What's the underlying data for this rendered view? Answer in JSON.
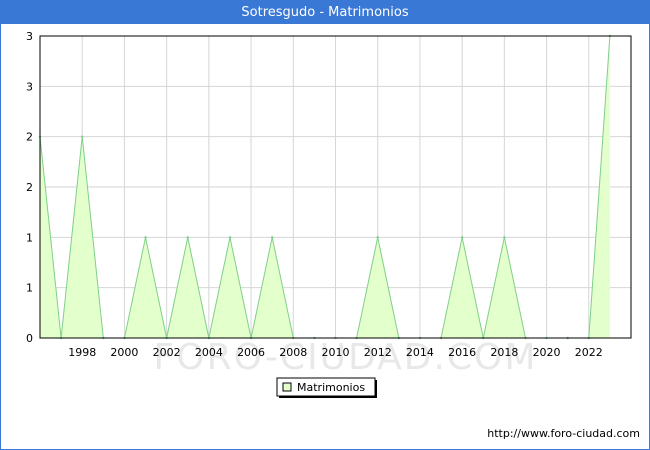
{
  "title": "Sotresgudo - Matrimonios",
  "footer_url": "http://www.foro-ciudad.com",
  "watermark": "FORO-CIUDAD.COM",
  "colors": {
    "title_bg": "#3a78d6",
    "fill": "#e3ffcc",
    "line": "#7fcf8a",
    "grid": "#d6d6d6"
  },
  "chart_data": {
    "type": "area",
    "title": "Sotresgudo - Matrimonios",
    "x": [
      1996,
      1997,
      1998,
      1999,
      2000,
      2001,
      2002,
      2003,
      2004,
      2005,
      2006,
      2007,
      2008,
      2009,
      2010,
      2011,
      2012,
      2013,
      2014,
      2015,
      2016,
      2017,
      2018,
      2019,
      2020,
      2021,
      2022,
      2023
    ],
    "series": [
      {
        "name": "Matrimonios",
        "values": [
          2,
          0,
          2,
          0,
          0,
          1,
          0,
          1,
          0,
          1,
          0,
          1,
          0,
          0,
          0,
          0,
          1,
          0,
          0,
          0,
          1,
          0,
          1,
          0,
          0,
          0,
          0,
          3
        ]
      }
    ],
    "x_ticks": [
      "1998",
      "2000",
      "2002",
      "2004",
      "2006",
      "2008",
      "2010",
      "2012",
      "2014",
      "2016",
      "2018",
      "2020",
      "2022"
    ],
    "y_ticks": [
      "0",
      "1",
      "1",
      "2",
      "2",
      "3",
      "3"
    ],
    "ylim": [
      0,
      3
    ],
    "xlim": [
      1996,
      2024
    ],
    "grid": true,
    "legend_position": "bottom-center"
  }
}
